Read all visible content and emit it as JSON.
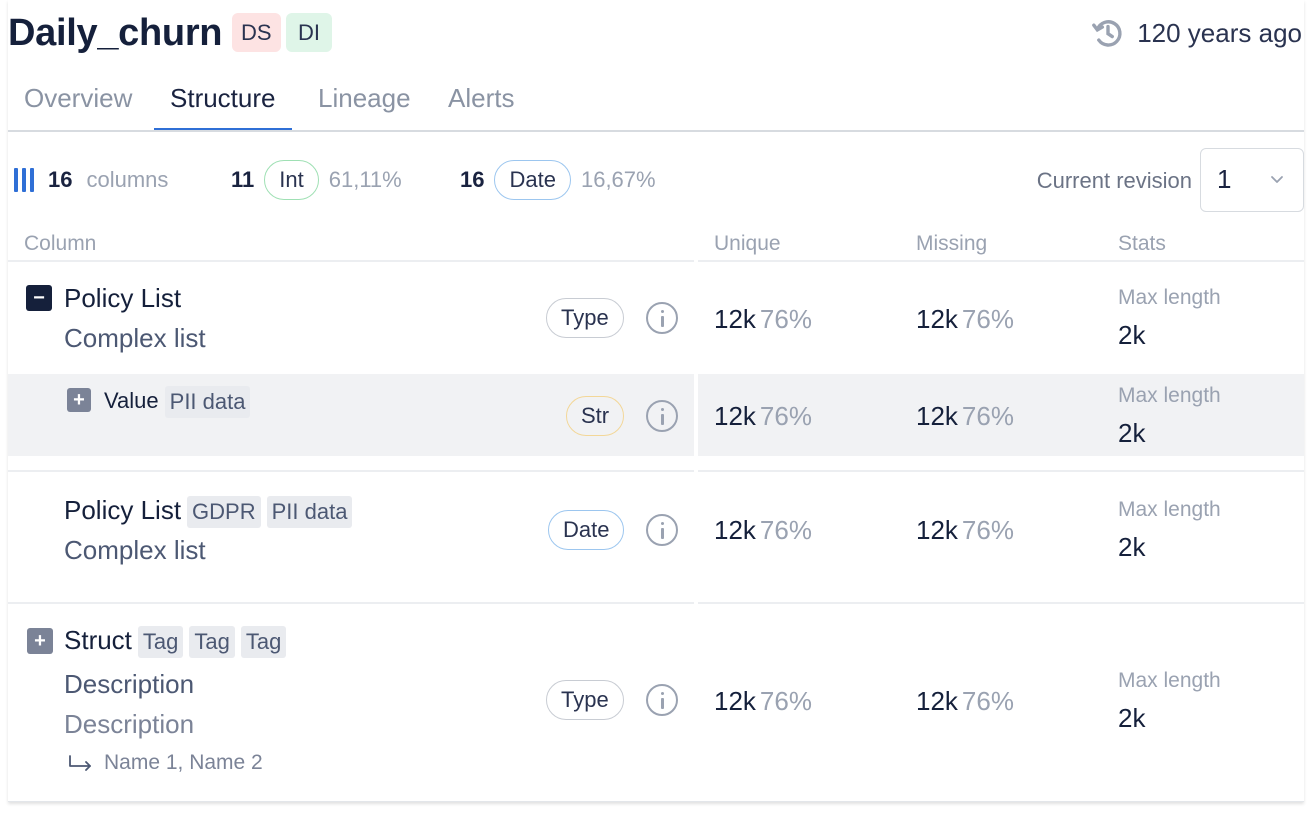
{
  "header": {
    "title": "Daily_churn",
    "badges": [
      "DS",
      "DI"
    ],
    "timestamp": "120 years ago"
  },
  "tabs": [
    {
      "label": "Overview",
      "active": false
    },
    {
      "label": "Structure",
      "active": true
    },
    {
      "label": "Lineage",
      "active": false
    },
    {
      "label": "Alerts",
      "active": false
    }
  ],
  "summary": {
    "total_count": "16",
    "total_label": "columns",
    "int": {
      "count": "11",
      "label": "Int",
      "percent": "61,11%"
    },
    "date": {
      "count": "16",
      "label": "Date",
      "percent": "16,67%"
    },
    "revision_label": "Current revision",
    "revision_value": "1"
  },
  "columns_header": {
    "column": "Column",
    "unique": "Unique",
    "missing": "Missing",
    "stats": "Stats"
  },
  "rows": [
    {
      "name": "Policy List",
      "description": "Complex list",
      "type": "Type",
      "unique": {
        "value": "12k",
        "percent": "76%"
      },
      "missing": {
        "value": "12k",
        "percent": "76%"
      },
      "stat_label": "Max length",
      "stat_value": "2k"
    },
    {
      "name": "Value",
      "tags": [
        "PII data"
      ],
      "type": "Str",
      "unique": {
        "value": "12k",
        "percent": "76%"
      },
      "missing": {
        "value": "12k",
        "percent": "76%"
      },
      "stat_label": "Max length",
      "stat_value": "2k"
    },
    {
      "name": "Policy List",
      "tags": [
        "GDPR",
        "PII data"
      ],
      "description": "Complex list",
      "type": "Date",
      "unique": {
        "value": "12k",
        "percent": "76%"
      },
      "missing": {
        "value": "12k",
        "percent": "76%"
      },
      "stat_label": "Max length",
      "stat_value": "2k"
    },
    {
      "name": "Struct",
      "tags": [
        "Tag",
        "Tag",
        "Tag"
      ],
      "description": "Description",
      "description2": "Description",
      "references": "Name 1, Name 2",
      "type": "Type",
      "unique": {
        "value": "12k",
        "percent": "76%"
      },
      "missing": {
        "value": "12k",
        "percent": "76%"
      },
      "stat_label": "Max length",
      "stat_value": "2k"
    }
  ],
  "colors": {
    "accent": "#2f6fd6",
    "title": "#15203b",
    "muted": "#9aa2b1",
    "badge_ds_bg": "#fde3e3",
    "badge_di_bg": "#dff5e8",
    "int_border": "#9fe0b4",
    "date_border": "#9cc6ef",
    "str_border": "#f3d798",
    "selected_row_bg": "#f1f2f4"
  },
  "icons": {
    "timestamp": "history-clock-icon",
    "columns": "columns-bars-icon",
    "revision": "chevron-down-icon",
    "info": "info-icon",
    "collapse": "minus-square-icon",
    "expand": "plus-square-icon",
    "reference": "return-arrow-icon"
  }
}
